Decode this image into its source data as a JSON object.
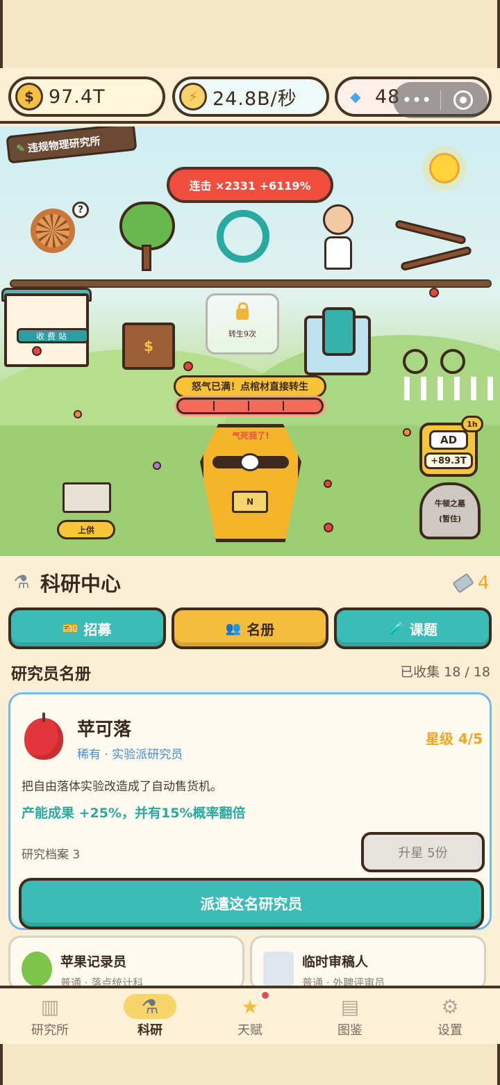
{
  "resources": {
    "coins": "97.4T",
    "energy": "24.8B/秒",
    "gems": "48"
  },
  "icons": {
    "coin": "coin-icon",
    "energy": "lightning-icon",
    "gem": "diamond-icon"
  },
  "capsule": {
    "more": "•••"
  },
  "scene": {
    "lab_name": "违规物理研究所",
    "combo": "连击 ×2331 +6119%",
    "locked_slot": "转生9次",
    "rage_title": "怒气已满！点棺材直接转生",
    "rage_level": 1.0,
    "coffin_shout": "气死我了!",
    "coffin_plate": "N",
    "stand_sign": "收费站",
    "supply_button": "上供",
    "ad_label": "AD",
    "ad_amount": "+89.3T",
    "ad_timer": "1h",
    "tomb_name": "牛顿之墓",
    "tomb_status": "(暂住)"
  },
  "research": {
    "title": "科研中心",
    "ticket_count": "4",
    "tabs": [
      {
        "label": "招募",
        "icon": "ticket-icon"
      },
      {
        "label": "名册",
        "icon": "people-icon"
      },
      {
        "label": "课题",
        "icon": "test-tube-icon"
      }
    ],
    "roster_title": "研究员名册",
    "roster_count": "已收集 18 / 18"
  },
  "featured": {
    "name": "苹可落",
    "meta": "稀有 · 实验派研究员",
    "stars": "星级 4/5",
    "description": "把自由落体实验改造成了自动售货机。",
    "effect": "产能成果 +25%，并有15%概率翻倍",
    "files": "研究档案 3",
    "upgrade_label": "升星 5份",
    "dispatch_label": "派遣这名研究员"
  },
  "others": [
    {
      "name": "苹果记录员",
      "sub": "普通 · 落点统计科"
    },
    {
      "name": "临时审稿人",
      "sub": "普通 · 外聘评审员"
    }
  ],
  "nav": [
    {
      "label": "研究所",
      "icon": "factory-icon"
    },
    {
      "label": "科研",
      "icon": "microscope-icon"
    },
    {
      "label": "天赋",
      "icon": "star-icon"
    },
    {
      "label": "图鉴",
      "icon": "book-icon"
    },
    {
      "label": "设置",
      "icon": "gear-icon"
    }
  ],
  "colors": {
    "teal": "#3cbcb6",
    "gold": "#f4be3c",
    "alert": "#ef4e3f",
    "rare_blue": "#3f8fd6"
  }
}
